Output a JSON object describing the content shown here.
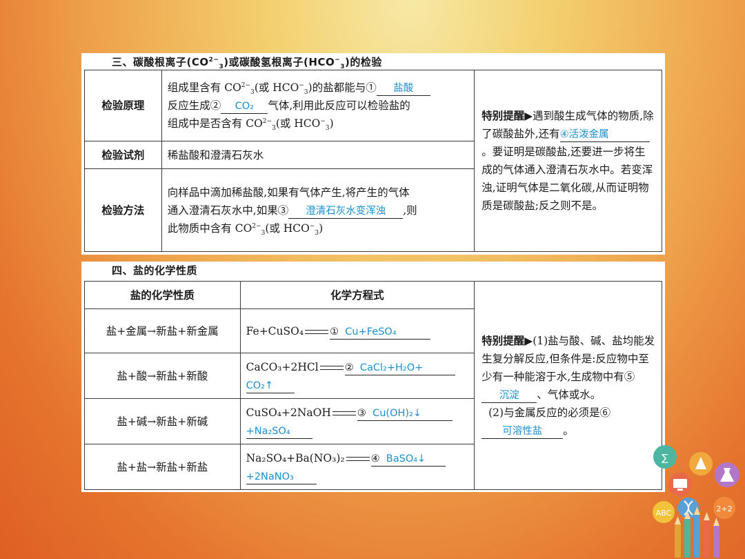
{
  "section3": {
    "title": "三、碳酸根离子(CO",
    "title_sup": "2−",
    "title_sub": "3",
    "title_mid": ")或碳酸氢根离子(HCO",
    "title_sup2": "−",
    "title_sub2": "3",
    "title_end": ")的检验",
    "rows": [
      {
        "label": "检验原理",
        "text_a": "组成里含有 CO",
        "text_b": "(或 HCO",
        "text_c": ")的盐都能与①",
        "ans1": "盐酸",
        "text_d": "反应生成②",
        "ans2": "CO₂",
        "text_e": "气体,利用此反应可以检验盐的",
        "text_f": "组成中是否含有 CO",
        "text_g": "(或 HCO",
        "text_h": ")"
      },
      {
        "label": "检验试剂",
        "text": "稀盐酸和澄清石灰水"
      },
      {
        "label": "检验方法",
        "text_a": "向样品中滴加稀盐酸,如果有气体产生,将产生的气体",
        "text_b": "通入澄清石灰水中,如果③",
        "ans3": "澄清石灰水变浑浊",
        "text_c": ",则",
        "text_d": "此物质中含有 CO",
        "text_e": "(或 HCO",
        "text_f": ")"
      }
    ],
    "tip": {
      "bold": "特别提醒▶",
      "text_a": "遇到酸生成气体的物质,除了碳酸盐外,还有",
      "ans4": "④活泼金属",
      "text_b": "。要证明是碳酸盐,还要进一步将生成的气体通入澄清石灰水中。若变浑浊,证明气体是二氧化碳,从而证明物质是碳酸盐;反之则不是。"
    }
  },
  "section4": {
    "title": "四、盐的化学性质",
    "header_prop": "盐的化学性质",
    "header_eq": "化学方程式",
    "rows": [
      {
        "prop": "盐+金属→新盐+新金属",
        "eq": "Fe+CuSO₄",
        "num": "①",
        "ans": "Cu+FeSO₄",
        "ans_b": ""
      },
      {
        "prop": "盐+酸→新盐+新酸",
        "eq": "CaCO₃+2HCl",
        "num": "②",
        "ans": "CaCl₂+H₂O+",
        "ans_b": "CO₂↑"
      },
      {
        "prop": "盐+碱→新盐+新碱",
        "eq": "CuSO₄+2NaOH",
        "num": "③",
        "ans": "Cu(OH)₂↓",
        "ans_b": "+Na₂SO₄"
      },
      {
        "prop": "盐+盐→新盐+新盐",
        "eq": "Na₂SO₄+Ba(NO₃)₂",
        "num": "④",
        "ans": "BaSO₄↓",
        "ans_b": "+2NaNO₃"
      }
    ],
    "tip": {
      "bold": "特别提醒▶",
      "text_a": "(1)盐与酸、碱、盐均能发生复分解反应,但条件是:反应物中至少有一种能溶于水,生成物中有⑤",
      "ans5": "沉淀",
      "text_b": "、气体或水。",
      "text_c": "(2)与金属反应的必须是⑥",
      "ans6": "可溶性盐",
      "text_d": "。"
    }
  },
  "colors": {
    "answer": "#1a8fd0",
    "background_top": "#f6e9a6",
    "background_bottom": "#de5f24"
  },
  "decorations": [
    "flask-icon",
    "computer-icon",
    "pencils-icon",
    "abc-icon",
    "math-icon",
    "dna-icon"
  ]
}
